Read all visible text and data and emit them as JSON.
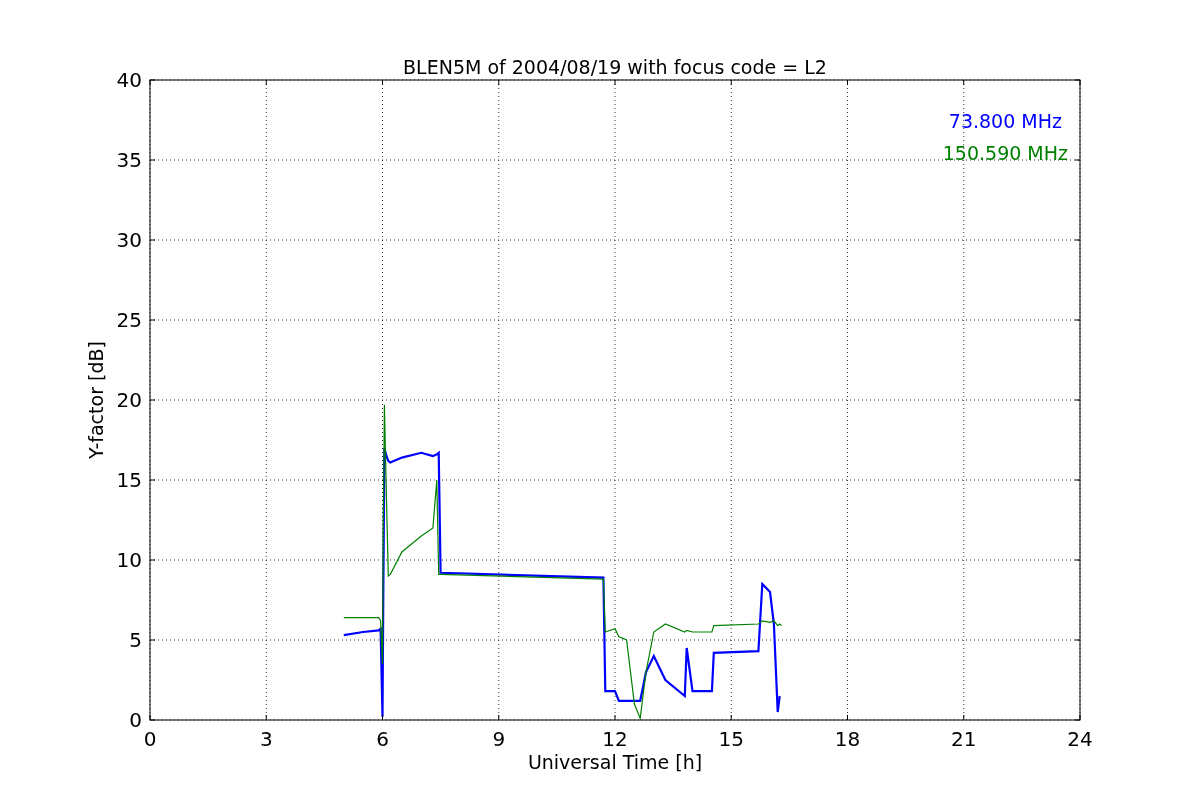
{
  "figure": {
    "chart_data": {
      "type": "line",
      "title": "BLEN5M of 2004/08/19 with focus code = L2",
      "xlabel": "Universal Time [h]",
      "ylabel": "Y-factor [dB]",
      "x": [
        5.0,
        5.5,
        5.9,
        5.95,
        6.0,
        6.02,
        6.05,
        6.1,
        6.15,
        6.2,
        6.5,
        7.0,
        7.3,
        7.4,
        7.45,
        7.5,
        11.7,
        11.75,
        12.0,
        12.1,
        12.3,
        12.5,
        12.65,
        12.8,
        13.0,
        13.3,
        13.8,
        13.85,
        14.0,
        14.5,
        14.55,
        15.7,
        15.8,
        16.0,
        16.1,
        16.2,
        16.25,
        16.3
      ],
      "series": [
        {
          "name": "73.800 MHz",
          "color": "#0000ff",
          "values": [
            5.3,
            5.5,
            5.6,
            5.7,
            0.2,
            8,
            17,
            16.5,
            16.2,
            16.1,
            16.4,
            16.7,
            16.5,
            16.6,
            16.7,
            9.2,
            8.9,
            1.8,
            1.8,
            1.2,
            1.2,
            1.2,
            1.2,
            3.0,
            4.0,
            2.5,
            1.5,
            4.5,
            1.8,
            1.8,
            4.2,
            4.3,
            8.5,
            8.0,
            6.0,
            0.5,
            1.5,
            null
          ]
        },
        {
          "name": "150.590 MHz",
          "color": "#008000",
          "values": [
            6.4,
            6.4,
            6.4,
            6.2,
            3.5,
            12,
            19.7,
            14,
            9.0,
            9.1,
            10.5,
            11.5,
            12.0,
            15.0,
            9.1,
            9.1,
            8.8,
            5.5,
            5.7,
            5.2,
            5.0,
            1.0,
            0.1,
            3.0,
            5.5,
            6.0,
            5.5,
            5.6,
            5.5,
            5.5,
            5.9,
            6.0,
            6.2,
            6.1,
            6.2,
            5.9,
            6.0,
            5.9
          ]
        }
      ],
      "grid": true,
      "xlim": [
        0,
        24
      ],
      "ylim": [
        0,
        40
      ],
      "xticks": [
        0,
        3,
        6,
        9,
        12,
        15,
        18,
        21,
        24
      ],
      "yticks": [
        0,
        5,
        10,
        15,
        20,
        25,
        30,
        35,
        40
      ]
    }
  }
}
